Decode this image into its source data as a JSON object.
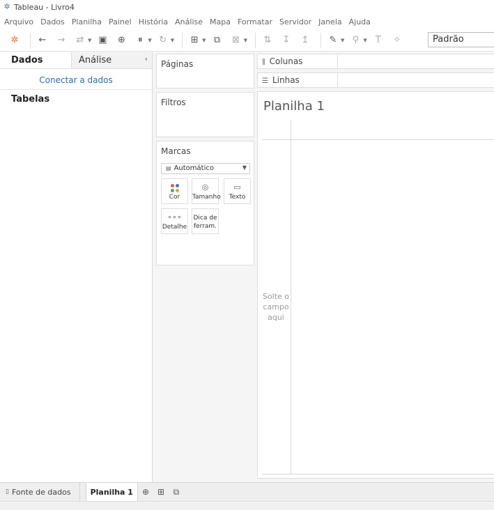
{
  "window": {
    "title": "Tableau - Livro4"
  },
  "menu": [
    "Arquivo",
    "Dados",
    "Planilha",
    "Painel",
    "História",
    "Análise",
    "Mapa",
    "Formatar",
    "Servidor",
    "Janela",
    "Ajuda"
  ],
  "toolbar": {
    "fit_select": "Padrão"
  },
  "data_pane": {
    "tab_data": "Dados",
    "tab_analytics": "Análise",
    "connect_link": "Conectar a dados",
    "tables_title": "Tabelas"
  },
  "cards": {
    "pages": "Páginas",
    "filters": "Filtros",
    "marks": "Marcas",
    "marks_type": "Automático",
    "btn_color": "Cor",
    "btn_size": "Tamanho",
    "btn_text": "Texto",
    "btn_detail": "Detalhe",
    "btn_tooltip_1": "Dica de",
    "btn_tooltip_2": "ferram."
  },
  "shelves": {
    "columns": "Colunas",
    "rows": "Linhas"
  },
  "view": {
    "sheet_title": "Planilha 1",
    "drop_hint_1": "Solte o",
    "drop_hint_2": "campo",
    "drop_hint_3": "aqui"
  },
  "bottom": {
    "data_source_tab": "Fonte de dados",
    "sheet_tab": "Planilha 1"
  },
  "colors": {
    "accent_link": "#3367b5",
    "tableau_blue": "#4a78b0"
  }
}
